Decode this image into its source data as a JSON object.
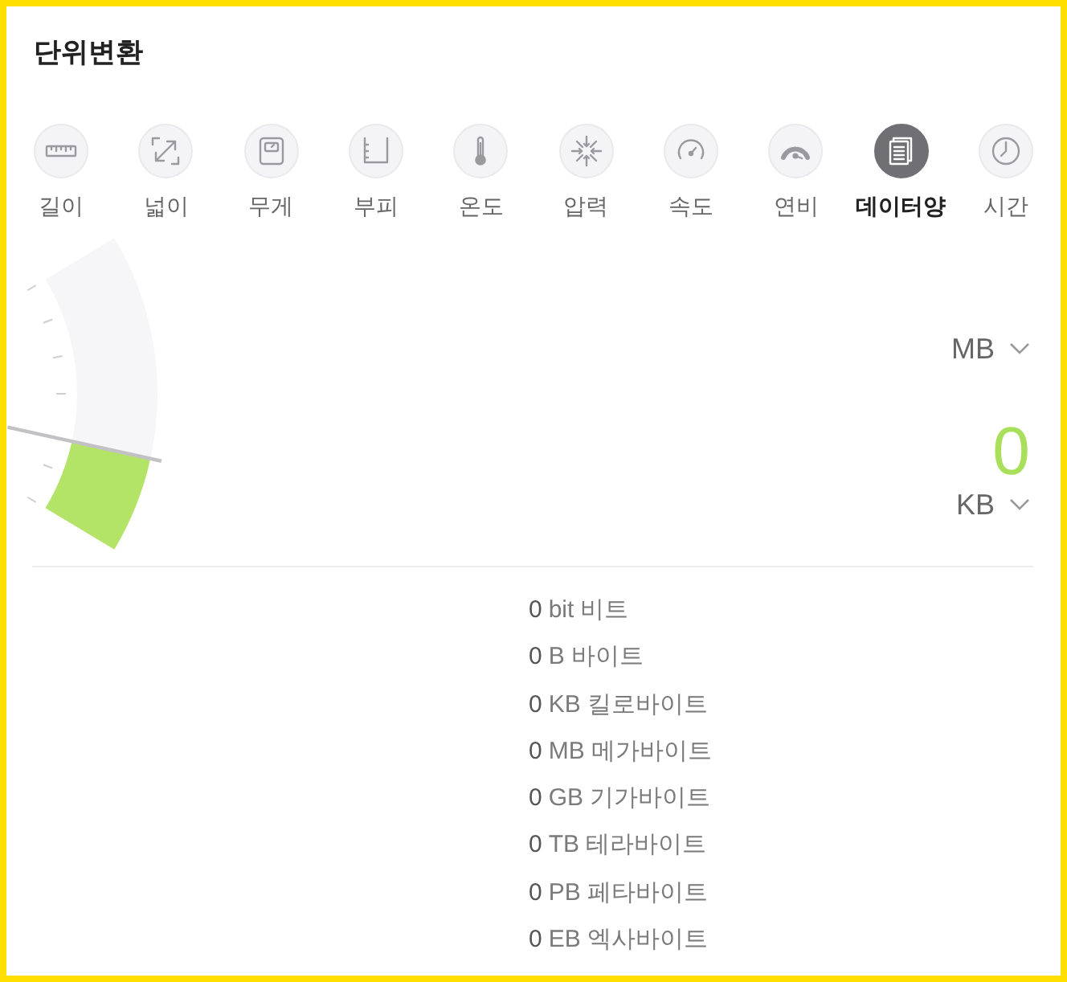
{
  "title": "단위변환",
  "categories": [
    {
      "label": "길이",
      "selected": false
    },
    {
      "label": "넓이",
      "selected": false
    },
    {
      "label": "무게",
      "selected": false
    },
    {
      "label": "부피",
      "selected": false
    },
    {
      "label": "온도",
      "selected": false
    },
    {
      "label": "압력",
      "selected": false
    },
    {
      "label": "속도",
      "selected": false
    },
    {
      "label": "연비",
      "selected": false
    },
    {
      "label": "데이터양",
      "selected": true
    },
    {
      "label": "시간",
      "selected": false
    }
  ],
  "gauge": {
    "level": 0.3
  },
  "converter": {
    "from_unit": "MB",
    "result": "0",
    "to_unit": "KB"
  },
  "results": [
    {
      "value": "0",
      "unit": "bit",
      "name": "비트"
    },
    {
      "value": "0",
      "unit": "B",
      "name": "바이트"
    },
    {
      "value": "0",
      "unit": "KB",
      "name": "킬로바이트"
    },
    {
      "value": "0",
      "unit": "MB",
      "name": "메가바이트"
    },
    {
      "value": "0",
      "unit": "GB",
      "name": "기가바이트"
    },
    {
      "value": "0",
      "unit": "TB",
      "name": "테라바이트"
    },
    {
      "value": "0",
      "unit": "PB",
      "name": "페타바이트"
    },
    {
      "value": "0",
      "unit": "EB",
      "name": "엑사바이트"
    }
  ]
}
